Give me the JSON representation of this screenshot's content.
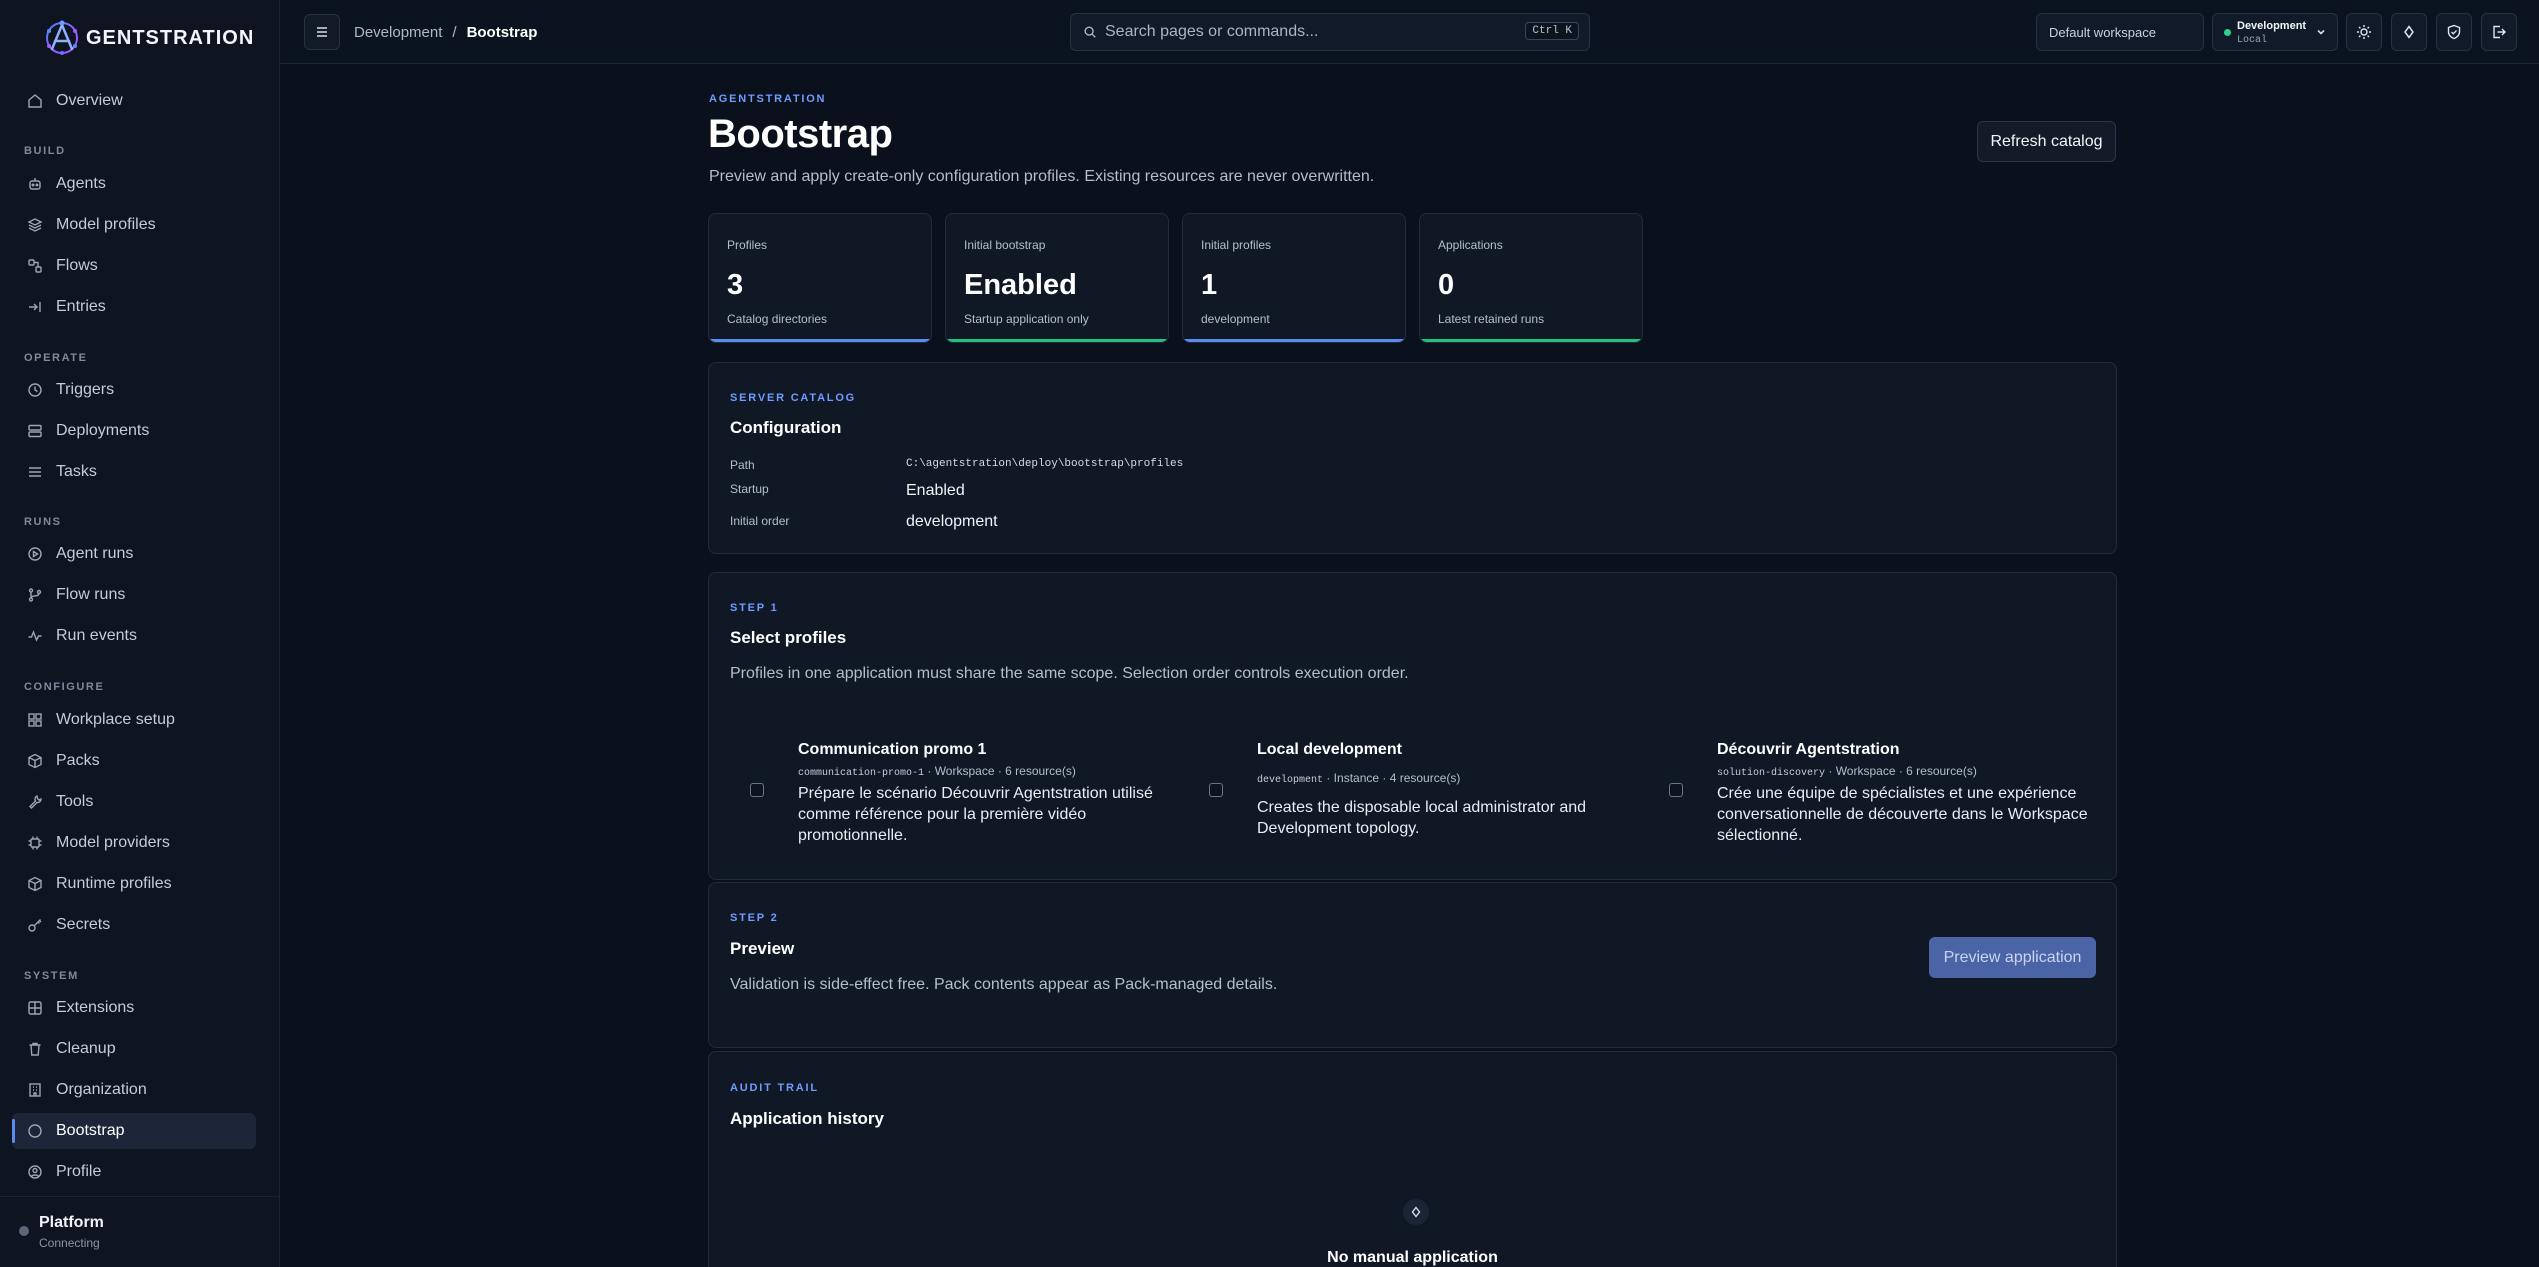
{
  "brand": {
    "name": "GENTSTRATION"
  },
  "sidebar": {
    "items": [
      {
        "label": "Overview",
        "icon": "home-icon"
      }
    ],
    "sections": [
      {
        "title": "BUILD",
        "items": [
          "Agents",
          "Model profiles",
          "Flows",
          "Entries"
        ]
      },
      {
        "title": "OPERATE",
        "items": [
          "Triggers",
          "Deployments",
          "Tasks"
        ]
      },
      {
        "title": "RUNS",
        "items": [
          "Agent runs",
          "Flow runs",
          "Run events"
        ]
      },
      {
        "title": "CONFIGURE",
        "items": [
          "Workplace setup",
          "Packs",
          "Tools",
          "Model providers",
          "Runtime profiles",
          "Secrets"
        ]
      },
      {
        "title": "SYSTEM",
        "items": [
          "Extensions",
          "Cleanup",
          "Organization",
          "Bootstrap",
          "Profile"
        ]
      }
    ],
    "active": "Bootstrap",
    "footer": {
      "name": "Platform",
      "status": "Connecting"
    }
  },
  "topbar": {
    "breadcrumb": [
      "Development",
      "/",
      "Bootstrap"
    ],
    "search_placeholder": "Search pages or commands...",
    "search_shortcut": "Ctrl K",
    "workspace": "Default workspace",
    "environment": {
      "name": "Development",
      "sub": "Local",
      "status_color": "#2fd08a"
    }
  },
  "page": {
    "eyebrow": "AGENTSTRATION",
    "title": "Bootstrap",
    "subtitle": "Preview and apply create-only configuration profiles. Existing resources are never overwritten.",
    "refresh_label": "Refresh catalog"
  },
  "stats": [
    {
      "label": "Profiles",
      "value": "3",
      "hint": "Catalog directories",
      "accent": "#5b8bf0"
    },
    {
      "label": "Initial bootstrap",
      "value": "Enabled",
      "hint": "Startup application only",
      "accent": "#22c07a"
    },
    {
      "label": "Initial profiles",
      "value": "1",
      "hint": "development",
      "accent": "#5b8bf0"
    },
    {
      "label": "Applications",
      "value": "0",
      "hint": "Latest retained runs",
      "accent": "#22c07a"
    }
  ],
  "catalog": {
    "eyebrow": "SERVER CATALOG",
    "title": "Configuration",
    "rows": [
      {
        "key": "Path",
        "value": "C:\\agentstration\\deploy\\bootstrap\\profiles"
      },
      {
        "key": "Startup",
        "value": "Enabled"
      },
      {
        "key": "Initial order",
        "value": "development"
      }
    ]
  },
  "step1": {
    "eyebrow": "STEP 1",
    "title": "Select profiles",
    "desc": "Profiles in one application must share the same scope. Selection order controls execution order.",
    "profiles": [
      {
        "name": "Communication promo 1",
        "slug": "communication-promo-1",
        "meta": " · Workspace · 6 resource(s)",
        "desc": "Prépare le scénario Découvrir Agentstration utilisé comme référence pour la première vidéo promotionnelle."
      },
      {
        "name": "Local development",
        "slug": "development",
        "meta": " · Instance · 4 resource(s)",
        "desc": "Creates the disposable local administrator and Development topology."
      },
      {
        "name": "Découvrir Agentstration",
        "slug": "solution-discovery",
        "meta": " · Workspace · 6 resource(s)",
        "desc": "Crée une équipe de spécialistes et une expérience conversationnelle de découverte dans le Workspace sélectionné."
      }
    ]
  },
  "step2": {
    "eyebrow": "STEP 2",
    "title": "Preview",
    "desc": "Validation is side-effect free. Pack contents appear as Pack-managed details.",
    "button": "Preview application"
  },
  "audit": {
    "eyebrow": "AUDIT TRAIL",
    "title": "Application history",
    "empty": "No manual application"
  }
}
